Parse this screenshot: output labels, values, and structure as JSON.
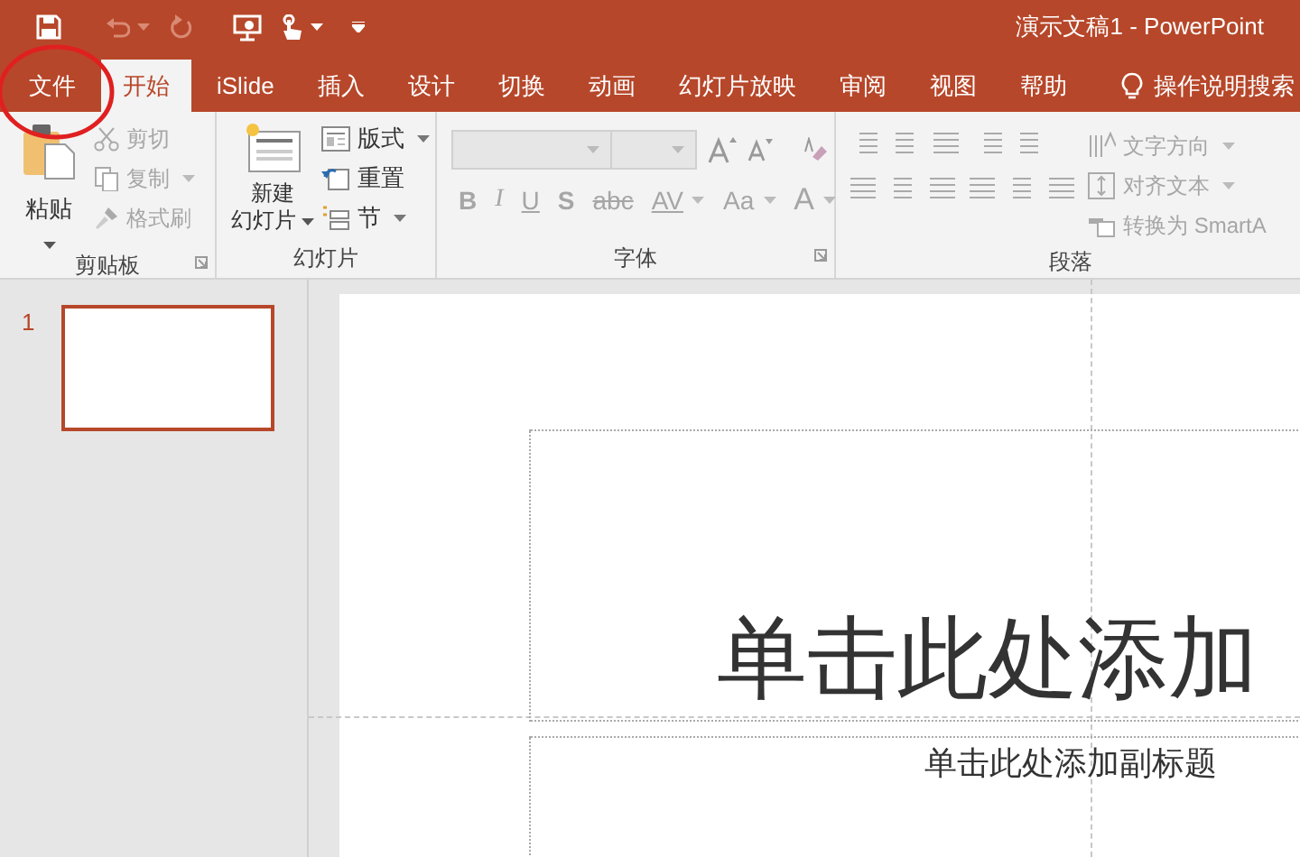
{
  "window": {
    "title": "演示文稿1 - PowerPoint"
  },
  "tabs": [
    {
      "label": "文件",
      "selected": false
    },
    {
      "label": "开始",
      "selected": true
    },
    {
      "label": "iSlide",
      "selected": false
    },
    {
      "label": "插入",
      "selected": false
    },
    {
      "label": "设计",
      "selected": false
    },
    {
      "label": "切换",
      "selected": false
    },
    {
      "label": "动画",
      "selected": false
    },
    {
      "label": "幻灯片放映",
      "selected": false
    },
    {
      "label": "审阅",
      "selected": false
    },
    {
      "label": "视图",
      "selected": false
    },
    {
      "label": "帮助",
      "selected": false
    }
  ],
  "tell_me": {
    "placeholder": "操作说明搜索"
  },
  "ribbon": {
    "clipboard": {
      "label": "剪贴板",
      "paste": "粘贴",
      "items": [
        {
          "label": "剪切",
          "disabled": true
        },
        {
          "label": "复制",
          "disabled": true
        },
        {
          "label": "格式刷",
          "disabled": true
        }
      ]
    },
    "slides": {
      "label": "幻灯片",
      "new_slide": [
        "新建",
        "幻灯片"
      ],
      "items": [
        {
          "label": "版式",
          "disabled": false
        },
        {
          "label": "重置",
          "disabled": false
        },
        {
          "label": "节",
          "disabled": false
        }
      ]
    },
    "font": {
      "label": "字体",
      "format_buttons": [
        {
          "label": "B",
          "disabled": true
        },
        {
          "label": "I",
          "disabled": true
        },
        {
          "label": "U",
          "disabled": true
        },
        {
          "label": "S",
          "disabled": true
        },
        {
          "label": "abc",
          "disabled": true
        },
        {
          "label": "AV",
          "disabled": true
        },
        {
          "label": "Aa",
          "disabled": true
        },
        {
          "label": "A",
          "disabled": true
        }
      ]
    },
    "paragraph": {
      "label": "段落",
      "items": [
        {
          "label": "文字方向",
          "disabled": true
        },
        {
          "label": "对齐文本",
          "disabled": true
        },
        {
          "label": "转换为 SmartA",
          "disabled": true
        }
      ]
    }
  },
  "slides_panel": {
    "thumbnails": [
      {
        "number": "1",
        "selected": true
      }
    ]
  },
  "slide": {
    "title_placeholder": "单击此处添加",
    "subtitle_placeholder": "单击此处添加副标题"
  }
}
